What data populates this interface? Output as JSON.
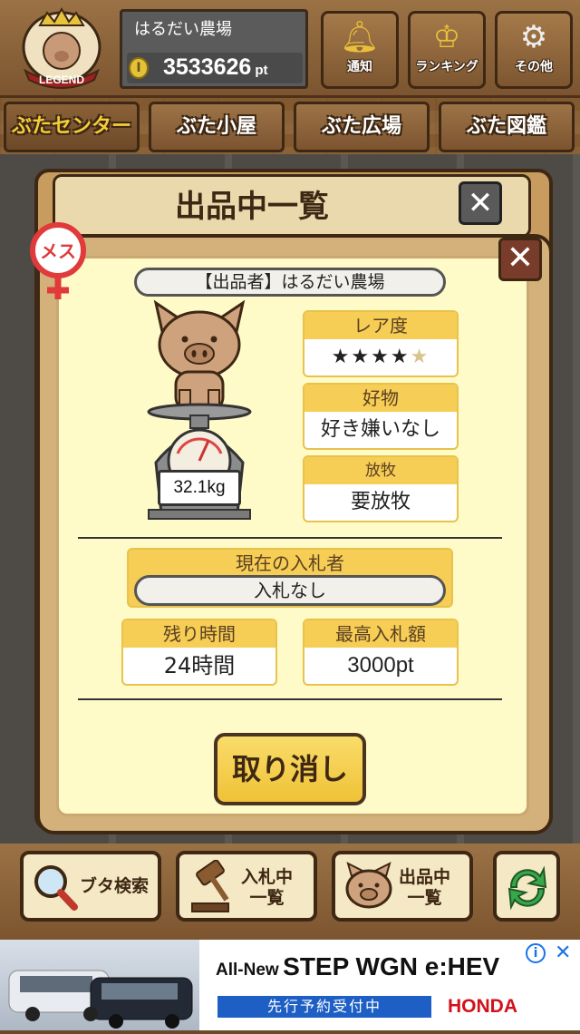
{
  "header": {
    "badge_text": "LEGEND",
    "farm_name": "はるだい農場",
    "points": "3533626",
    "points_unit": "pt",
    "buttons": [
      {
        "label": "通知",
        "icon": "bell-icon"
      },
      {
        "label": "ランキング",
        "icon": "crown-icon"
      },
      {
        "label": "その他",
        "icon": "gear-icon"
      }
    ]
  },
  "tabs": [
    {
      "label": "ぶたセンター",
      "active": true
    },
    {
      "label": "ぶた小屋",
      "active": false
    },
    {
      "label": "ぶた広場",
      "active": false
    },
    {
      "label": "ぶた図鑑",
      "active": false
    }
  ],
  "list_dialog": {
    "title": "出品中一覧",
    "close": "✕"
  },
  "detail": {
    "close": "✕",
    "gender_label": "メス",
    "seller": "【出品者】はるだい農場",
    "weight": "32.1kg",
    "rarity": {
      "label": "レア度",
      "stars_filled": 4,
      "stars_total": 5,
      "filled_color": "#e27f79",
      "empty_color": "#d8c58d"
    },
    "favorite": {
      "label": "好物",
      "value": "好き嫌いなし"
    },
    "grazing": {
      "label": "放牧",
      "value": "要放牧"
    },
    "current_bidder": {
      "label": "現在の入札者",
      "value": "入札なし"
    },
    "remaining_time": {
      "label": "残り時間",
      "value": "24時間"
    },
    "highest_bid": {
      "label": "最高入札額",
      "value": "3000pt"
    },
    "cancel_button": "取り消し"
  },
  "bottom_nav": [
    {
      "label": "ブタ検索",
      "icon": "magnifier-icon"
    },
    {
      "label_line1": "入札中",
      "label_line2": "一覧",
      "icon": "gavel-icon"
    },
    {
      "label_line1": "出品中",
      "label_line2": "一覧",
      "icon": "pig-face-icon"
    },
    {
      "label": "",
      "icon": "refresh-icon"
    }
  ],
  "ad": {
    "headline_small": "All-New",
    "headline_big": "STEP WGN e:HEV",
    "sub": "先行予約受付中",
    "brand": "HONDA",
    "info_icon": "i",
    "close_icon": "✕"
  },
  "colors": {
    "accent_yellow": "#f6cd55",
    "wood_brown": "#8a6238",
    "card_cream": "#fffbc8",
    "female_red": "#e03a3a"
  }
}
